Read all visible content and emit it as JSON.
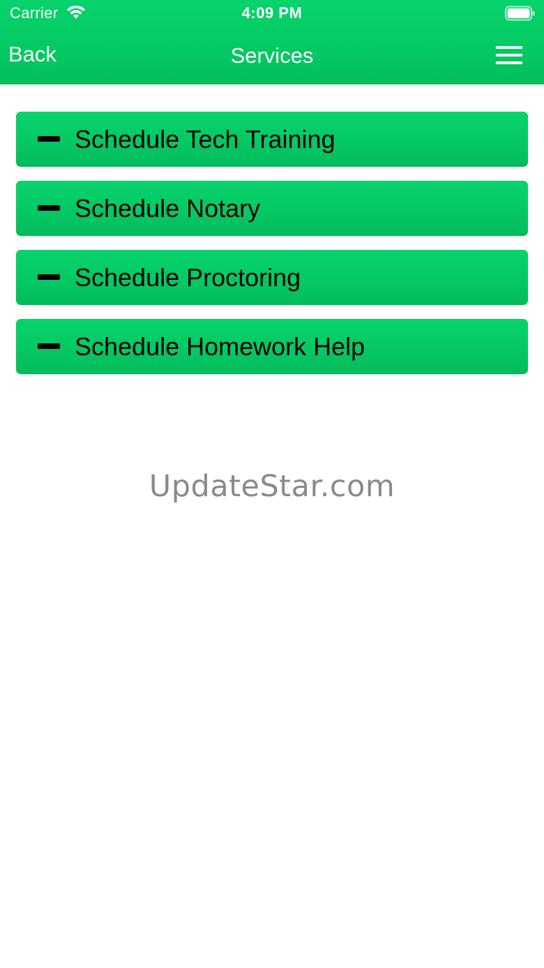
{
  "status_bar": {
    "carrier": "Carrier",
    "time": "4:09 PM",
    "wifi_icon": "wifi-icon",
    "battery_icon": "battery-icon"
  },
  "nav": {
    "back_label": "Back",
    "title": "Services",
    "menu_icon": "hamburger-menu-icon"
  },
  "services": [
    {
      "label": "Schedule Tech Training",
      "icon": "minus-icon"
    },
    {
      "label": "Schedule Notary",
      "icon": "minus-icon"
    },
    {
      "label": "Schedule Proctoring",
      "icon": "minus-icon"
    },
    {
      "label": "Schedule Homework Help",
      "icon": "minus-icon"
    }
  ],
  "watermark": "UpdateStar.com",
  "colors": {
    "accent_green": "#04c964",
    "text_dark": "#000000",
    "text_light": "#ffffff",
    "watermark_gray": "#8a8a8a"
  }
}
